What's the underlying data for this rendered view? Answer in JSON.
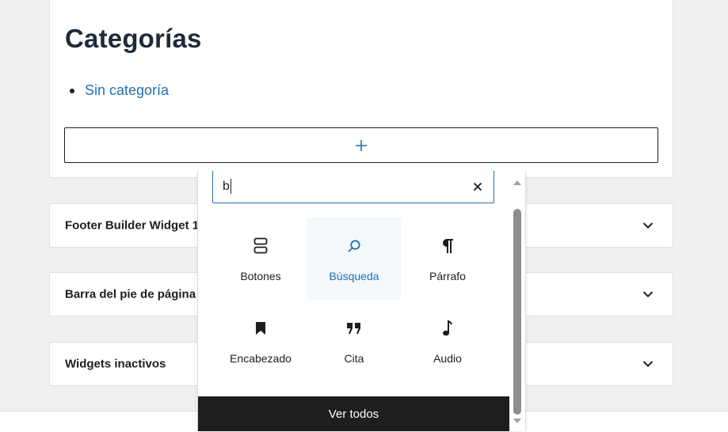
{
  "main_widget": {
    "title": "Categorías",
    "categories": [
      "Sin categoría"
    ]
  },
  "widget_areas": [
    {
      "label": "Footer Builder Widget 1"
    },
    {
      "label": "Barra del pie de página 2"
    },
    {
      "label": "Widgets inactivos"
    }
  ],
  "inserter": {
    "search_value": "b",
    "blocks": [
      {
        "name": "Botones",
        "icon": "buttons-icon"
      },
      {
        "name": "Búsqueda",
        "icon": "search-icon"
      },
      {
        "name": "Párrafo",
        "icon": "paragraph-icon"
      },
      {
        "name": "Encabezado",
        "icon": "bookmark-icon"
      },
      {
        "name": "Cita",
        "icon": "quote-icon"
      },
      {
        "name": "Audio",
        "icon": "music-note-icon"
      }
    ],
    "view_all_label": "Ver todos"
  },
  "colors": {
    "accent": "#2271b1",
    "text": "#1e1e1e",
    "background": "#f0f0f1",
    "dark_button": "#1e1e1e"
  }
}
